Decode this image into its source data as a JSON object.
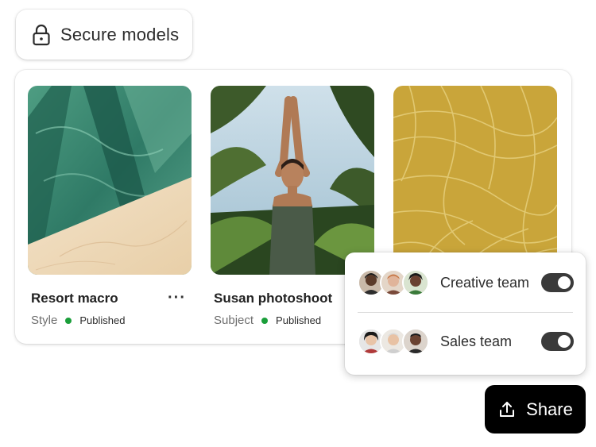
{
  "header_chip": {
    "label": "Secure models",
    "icon": "lock-icon"
  },
  "cards": [
    {
      "title": "Resort macro",
      "type": "Style",
      "status": "Published",
      "status_color": "#1a9e3a",
      "more": "···"
    },
    {
      "title": "Susan photoshoot",
      "type": "Subject",
      "status": "Published",
      "status_color": "#1a9e3a"
    },
    {
      "title": "",
      "type": "",
      "status": ""
    }
  ],
  "share_popover": {
    "teams": [
      {
        "name": "Creative team",
        "enabled": true
      },
      {
        "name": "Sales team",
        "enabled": true
      }
    ]
  },
  "share_button": {
    "label": "Share",
    "icon": "share-upload-icon"
  }
}
